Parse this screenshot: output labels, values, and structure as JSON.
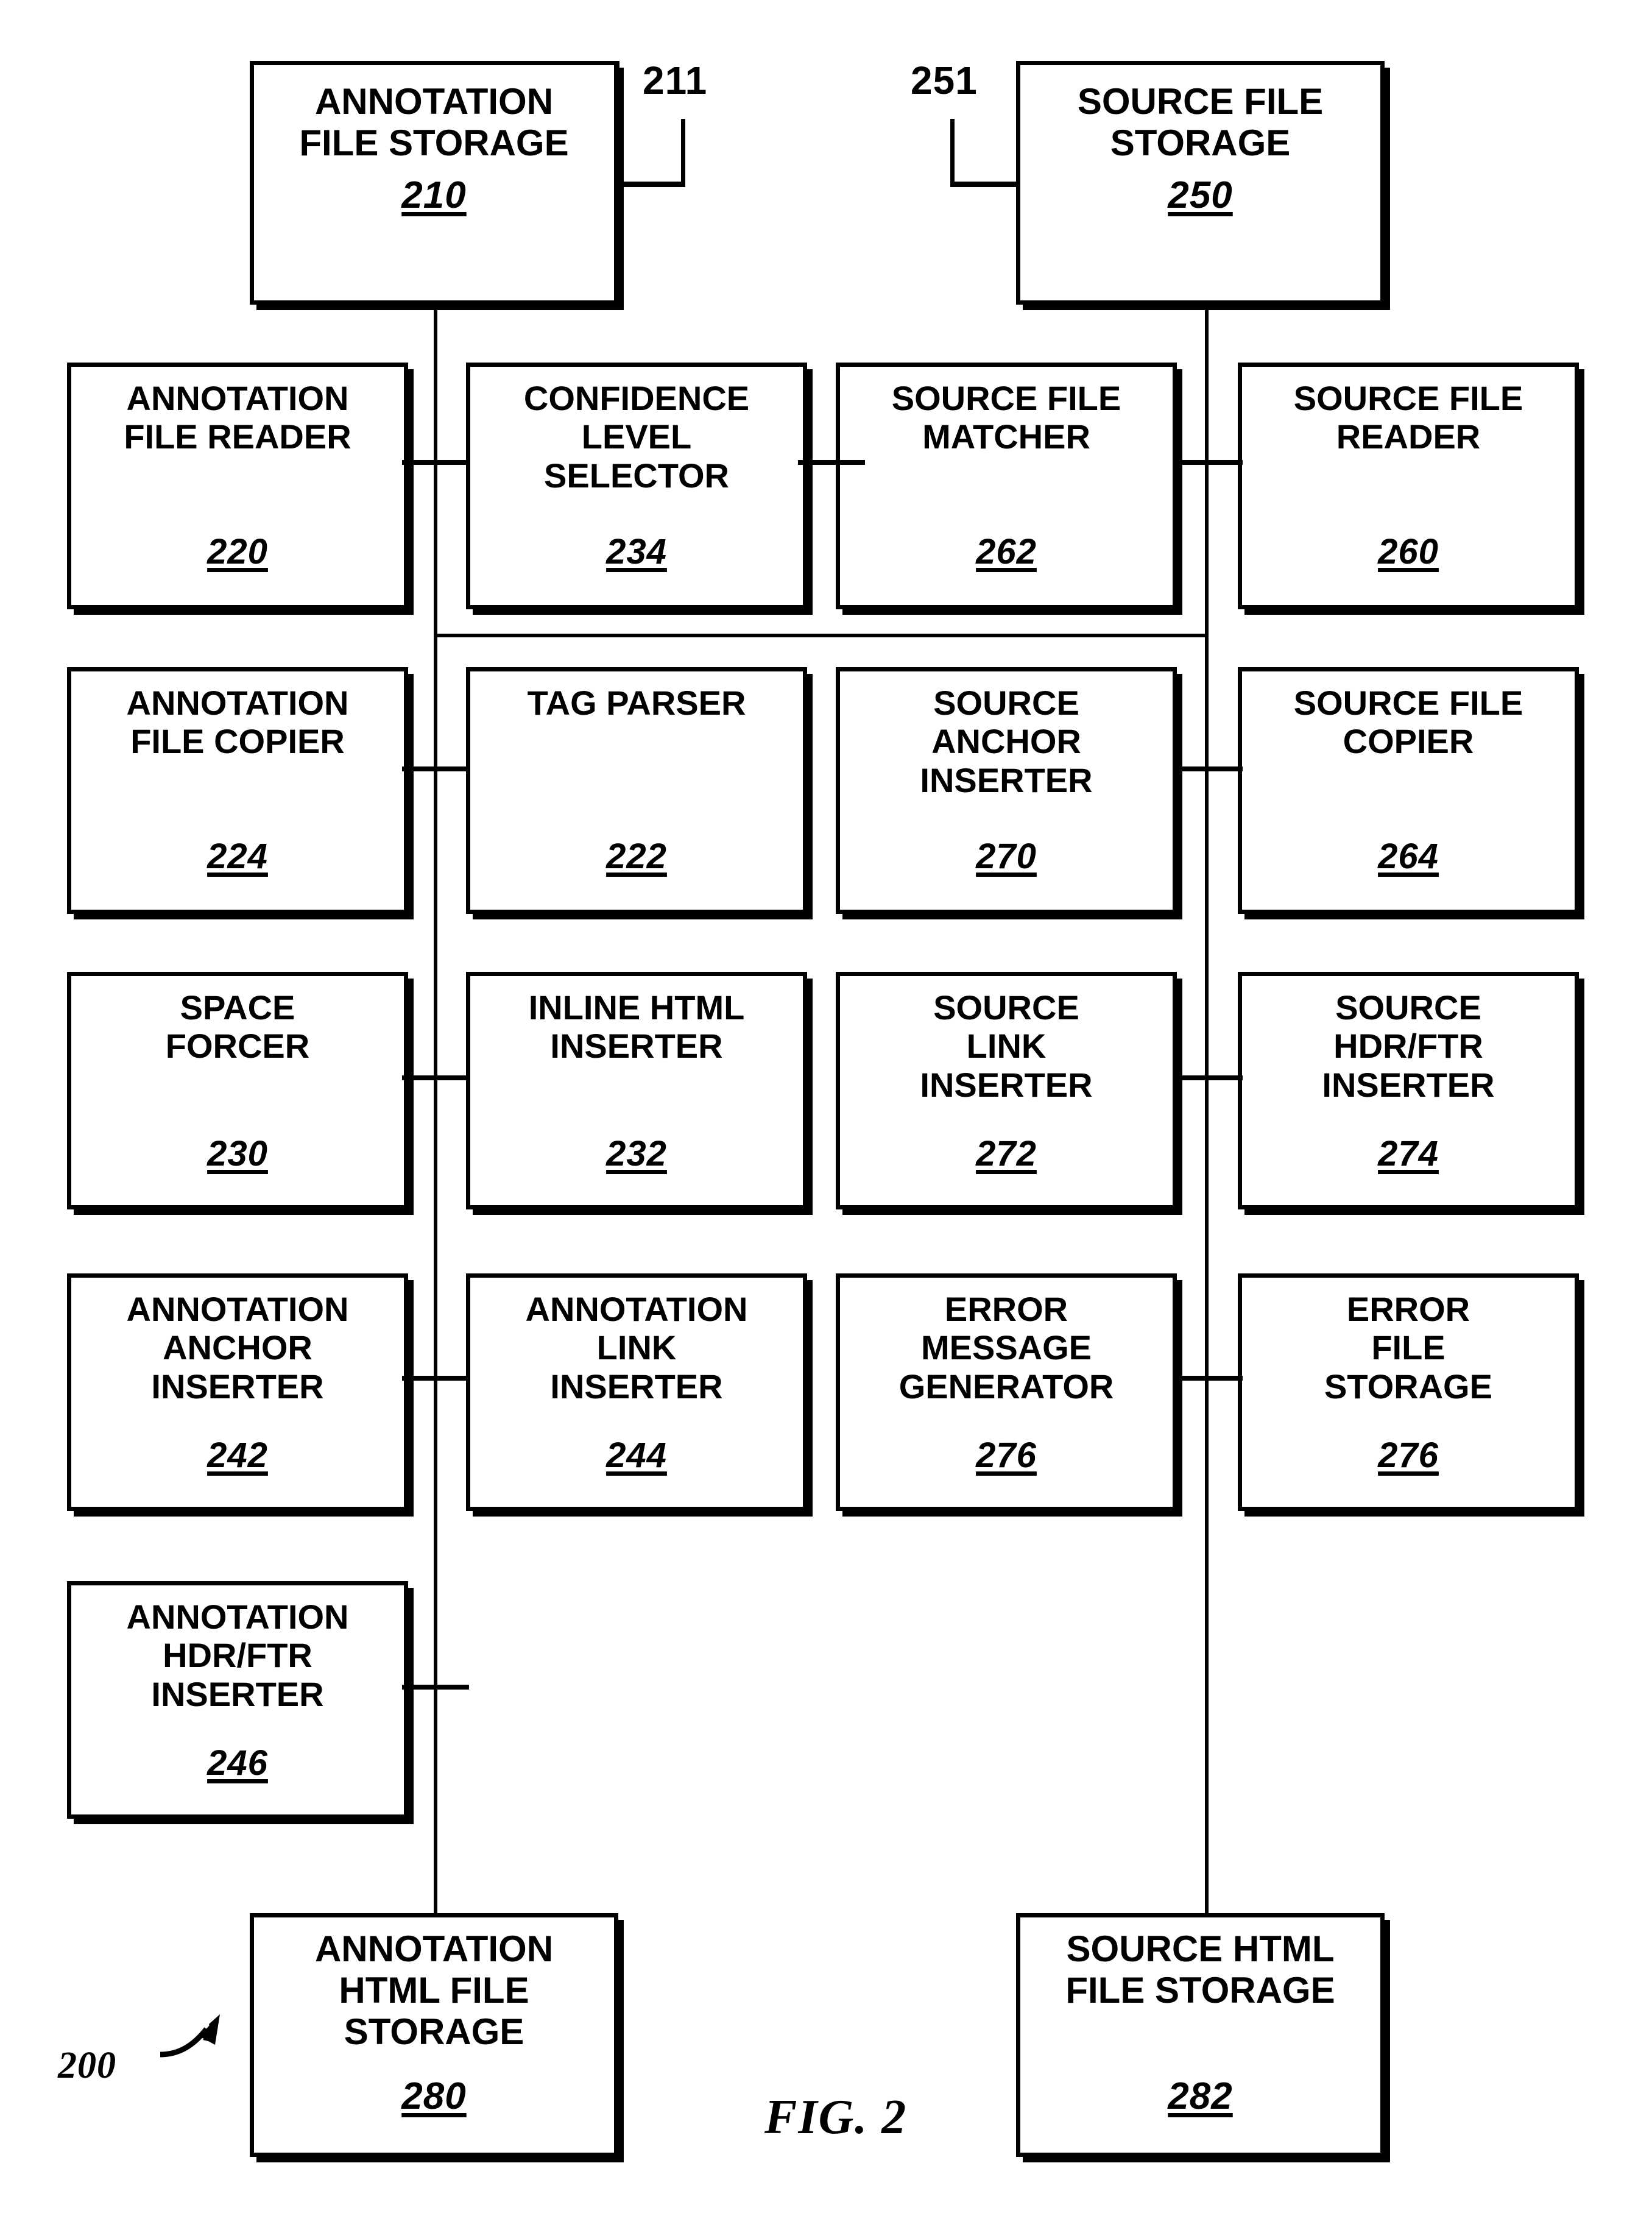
{
  "figure": {
    "caption": "FIG. 2",
    "system_ref": "200"
  },
  "callouts": [
    {
      "id": "callout-211",
      "label": "211"
    },
    {
      "id": "callout-251",
      "label": "251"
    }
  ],
  "storage_boxes": {
    "annotation_file_storage": {
      "title": "ANNOTATION\nFILE STORAGE",
      "ref": "210"
    },
    "source_file_storage": {
      "title": "SOURCE FILE\nSTORAGE",
      "ref": "250"
    },
    "annotation_html_file_storage": {
      "title": "ANNOTATION\nHTML FILE\nSTORAGE",
      "ref": "280"
    },
    "source_html_file_storage": {
      "title": "SOURCE HTML\nFILE STORAGE",
      "ref": "282"
    }
  },
  "rows": [
    {
      "row": 1,
      "boxes": [
        {
          "title": "ANNOTATION\nFILE READER",
          "ref": "220"
        },
        {
          "title": "CONFIDENCE\nLEVEL\nSELECTOR",
          "ref": "234"
        },
        {
          "title": "SOURCE FILE\nMATCHER",
          "ref": "262"
        },
        {
          "title": "SOURCE FILE\nREADER",
          "ref": "260"
        }
      ]
    },
    {
      "row": 2,
      "boxes": [
        {
          "title": "ANNOTATION\nFILE COPIER",
          "ref": "224"
        },
        {
          "title": "TAG PARSER",
          "ref": "222"
        },
        {
          "title": "SOURCE\nANCHOR\nINSERTER",
          "ref": "270"
        },
        {
          "title": "SOURCE FILE\nCOPIER",
          "ref": "264"
        }
      ]
    },
    {
      "row": 3,
      "boxes": [
        {
          "title": "SPACE\nFORCER",
          "ref": "230"
        },
        {
          "title": "INLINE HTML\nINSERTER",
          "ref": "232"
        },
        {
          "title": "SOURCE\nLINK\nINSERTER",
          "ref": "272"
        },
        {
          "title": "SOURCE\nHDR/FTR\nINSERTER",
          "ref": "274"
        }
      ]
    },
    {
      "row": 4,
      "boxes": [
        {
          "title": "ANNOTATION\nANCHOR\nINSERTER",
          "ref": "242"
        },
        {
          "title": "ANNOTATION\nLINK\nINSERTER",
          "ref": "244"
        },
        {
          "title": "ERROR\nMESSAGE\nGENERATOR",
          "ref": "276"
        },
        {
          "title": "ERROR\nFILE\nSTORAGE",
          "ref": "276"
        }
      ]
    },
    {
      "row": 5,
      "boxes": [
        {
          "title": "ANNOTATION\nHDR/FTR\nINSERTER",
          "ref": "246"
        }
      ]
    }
  ],
  "colors": {
    "ink": "#000000",
    "paper": "#ffffff"
  }
}
